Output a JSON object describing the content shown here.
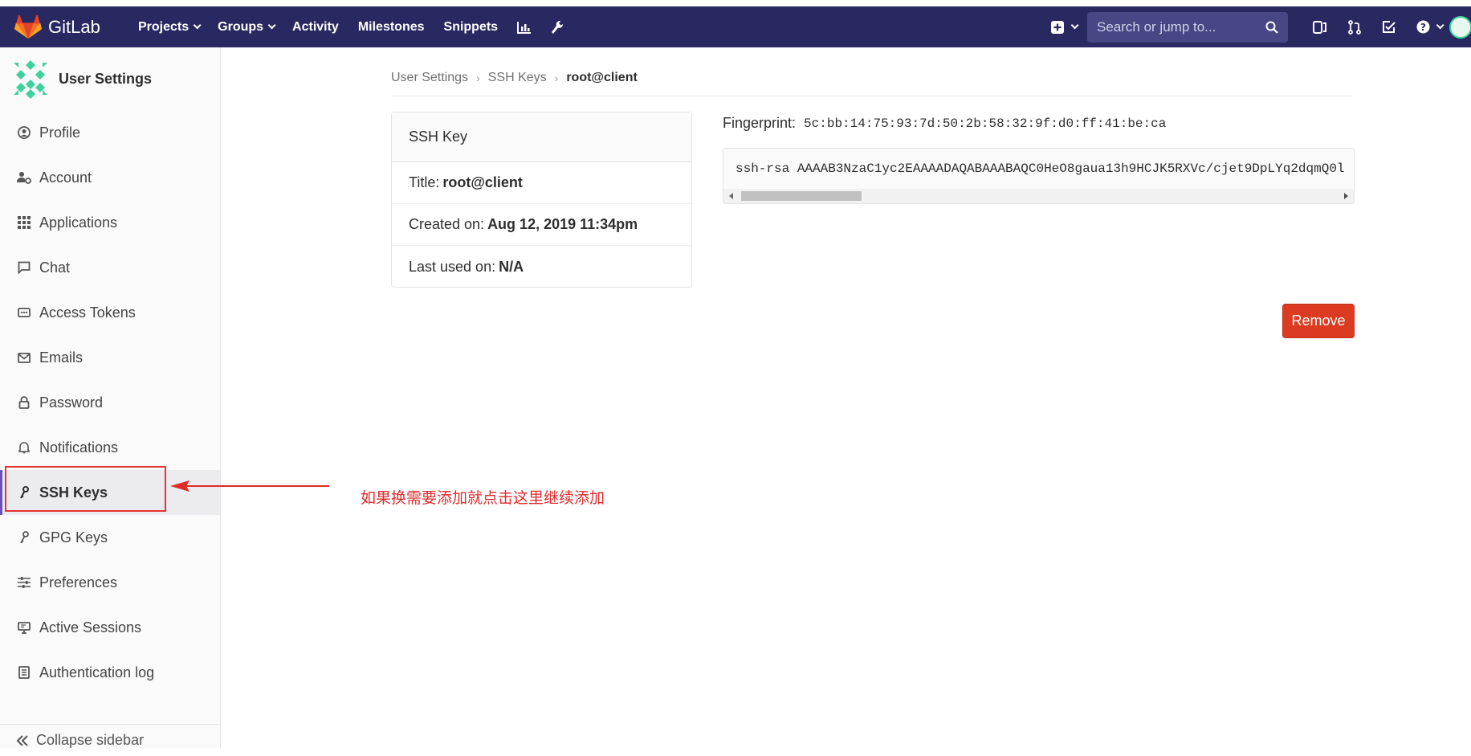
{
  "navbar": {
    "brand": "GitLab",
    "links": [
      {
        "label": "Projects",
        "dropdown": true
      },
      {
        "label": "Groups",
        "dropdown": true
      },
      {
        "label": "Activity",
        "dropdown": false
      },
      {
        "label": "Milestones",
        "dropdown": false
      },
      {
        "label": "Snippets",
        "dropdown": false
      }
    ],
    "icons": [
      "chart-icon",
      "wrench-icon",
      "plus-square-icon",
      "search-icon",
      "issues-icon",
      "merge-request-icon",
      "todo-icon",
      "help-icon",
      "avatar"
    ],
    "search_placeholder": "Search or jump to...",
    "bg_color": "#292961"
  },
  "sidebar": {
    "title": "User Settings",
    "items": [
      {
        "label": "Profile",
        "icon": "profile-icon"
      },
      {
        "label": "Account",
        "icon": "account-icon"
      },
      {
        "label": "Applications",
        "icon": "applications-icon"
      },
      {
        "label": "Chat",
        "icon": "chat-icon"
      },
      {
        "label": "Access Tokens",
        "icon": "token-icon"
      },
      {
        "label": "Emails",
        "icon": "email-icon"
      },
      {
        "label": "Password",
        "icon": "lock-icon"
      },
      {
        "label": "Notifications",
        "icon": "bell-icon"
      },
      {
        "label": "SSH Keys",
        "icon": "key-icon",
        "active": true
      },
      {
        "label": "GPG Keys",
        "icon": "key-icon"
      },
      {
        "label": "Preferences",
        "icon": "sliders-icon"
      },
      {
        "label": "Active Sessions",
        "icon": "monitor-icon"
      },
      {
        "label": "Authentication log",
        "icon": "log-icon"
      }
    ],
    "collapse_label": "Collapse sidebar"
  },
  "breadcrumb": {
    "items": [
      "User Settings",
      "SSH Keys"
    ],
    "current": "root@client"
  },
  "ssh_key": {
    "card_title": "SSH Key",
    "title_label": "Title:",
    "title_value": "root@client",
    "created_label": "Created on:",
    "created_value": "Aug 12, 2019 11:34pm",
    "last_used_label": "Last used on:",
    "last_used_value": "N/A",
    "fingerprint_label": "Fingerprint:",
    "fingerprint_value": "5c:bb:14:75:93:7d:50:2b:58:32:9f:d0:ff:41:be:ca",
    "key_text": "ssh-rsa AAAAB3NzaC1yc2EAAAADAQABAAABAQC0HeO8gaua13h9HCJK5RXVc/cjet9DpLYq2dqmQ0l",
    "remove_label": "Remove",
    "remove_color": "#db3b21"
  },
  "annotation": {
    "text": "如果换需要添加就点击这里继续添加",
    "color": "#e02b2b"
  }
}
